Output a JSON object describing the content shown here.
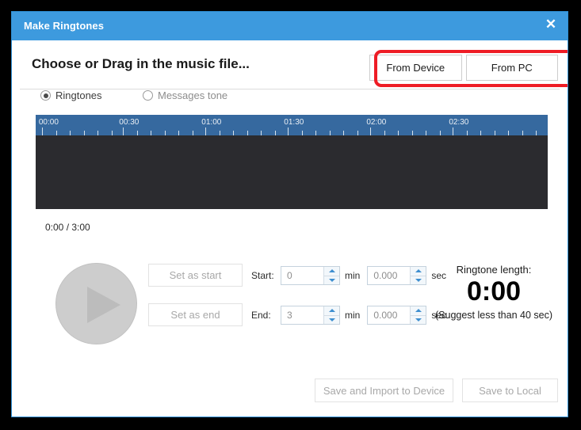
{
  "window": {
    "title": "Make Ringtones",
    "close_icon": "close-icon"
  },
  "header": {
    "title": "Choose or Drag in the music file...",
    "sources": [
      {
        "label": "From Device"
      },
      {
        "label": "From PC"
      }
    ]
  },
  "tone_type": {
    "options": [
      {
        "label": "Ringtones",
        "selected": true
      },
      {
        "label": "Messages tone",
        "selected": false
      }
    ]
  },
  "timeline": {
    "labels": [
      "00:00",
      "00:30",
      "01:00",
      "01:30",
      "02:00",
      "02:30"
    ],
    "label_positions_pct": [
      0.6,
      16.3,
      32.4,
      48.5,
      64.6,
      80.7
    ],
    "major_tick_pct": [
      1.2,
      17.0,
      33.1,
      49.2,
      65.3,
      81.4
    ],
    "minor_tick_pct": [
      4.0,
      6.7,
      9.4,
      12.1,
      14.8,
      19.8,
      22.5,
      25.2,
      27.9,
      30.6,
      35.9,
      38.6,
      41.3,
      44.0,
      46.7,
      52.0,
      54.7,
      57.4,
      60.1,
      62.8,
      68.1,
      70.8,
      73.5,
      76.2,
      78.9,
      84.2,
      86.9,
      89.6,
      92.3,
      95.0,
      97.7
    ],
    "position_readout": "0:00 / 3:00",
    "ruler_color": "#36699f",
    "wave_color": "#2b2b2f"
  },
  "controls": {
    "play_icon": "play-icon",
    "set_as_start_label": "Set as start",
    "set_as_end_label": "Set as end",
    "start": {
      "label": "Start:",
      "min_value": "0",
      "min_unit": "min",
      "sec_value": "0.000",
      "sec_unit": "sec"
    },
    "end": {
      "label": "End:",
      "min_value": "3",
      "min_unit": "min",
      "sec_value": "0.000",
      "sec_unit": "sec"
    }
  },
  "ringtone_length": {
    "caption": "Ringtone length:",
    "value": "0:00",
    "hint": "(Suggest less than 40 sec)"
  },
  "footer": {
    "save_import_label": "Save and Import to Device",
    "save_local_label": "Save to Local"
  },
  "annotation": {
    "highlight_color": "#ee1c25"
  }
}
